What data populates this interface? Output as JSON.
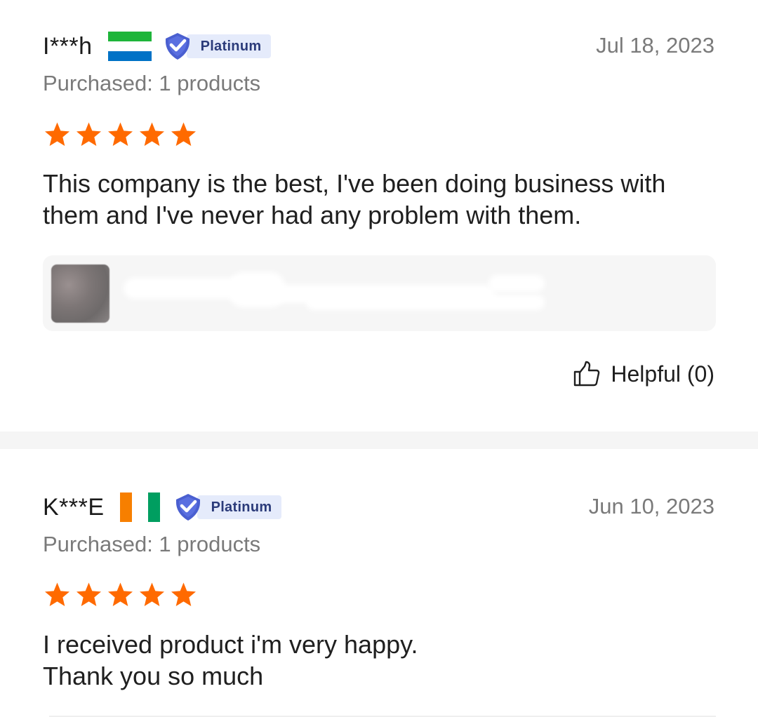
{
  "reviews": [
    {
      "username": "I***h",
      "flag": "sierra-leone-flag",
      "badge_label": "Platinum",
      "date": "Jul 18, 2023",
      "purchased": "Purchased: 1 products",
      "rating": 5,
      "comment": "This company is the best, I've been doing business with them and I've never had any problem with them.",
      "helpful_label": "Helpful (0)"
    },
    {
      "username": "K***E",
      "flag": "ivory-coast-flag",
      "badge_label": "Platinum",
      "date": "Jun 10, 2023",
      "purchased": "Purchased: 1 products",
      "rating": 5,
      "comment_lines": [
        "I received product i'm very happy.",
        "Thank you so much"
      ]
    }
  ],
  "colors": {
    "star": "#ff6a00",
    "badge_bg": "#e5ebfb",
    "badge_shield": "#4a5fd0",
    "badge_text": "#2b3b7a",
    "muted_text": "#7a7a7a",
    "sl_green": "#1eb53a",
    "sl_white": "#ffffff",
    "sl_blue": "#0072c6",
    "ci_orange": "#f77f00",
    "ci_green": "#009e60"
  }
}
